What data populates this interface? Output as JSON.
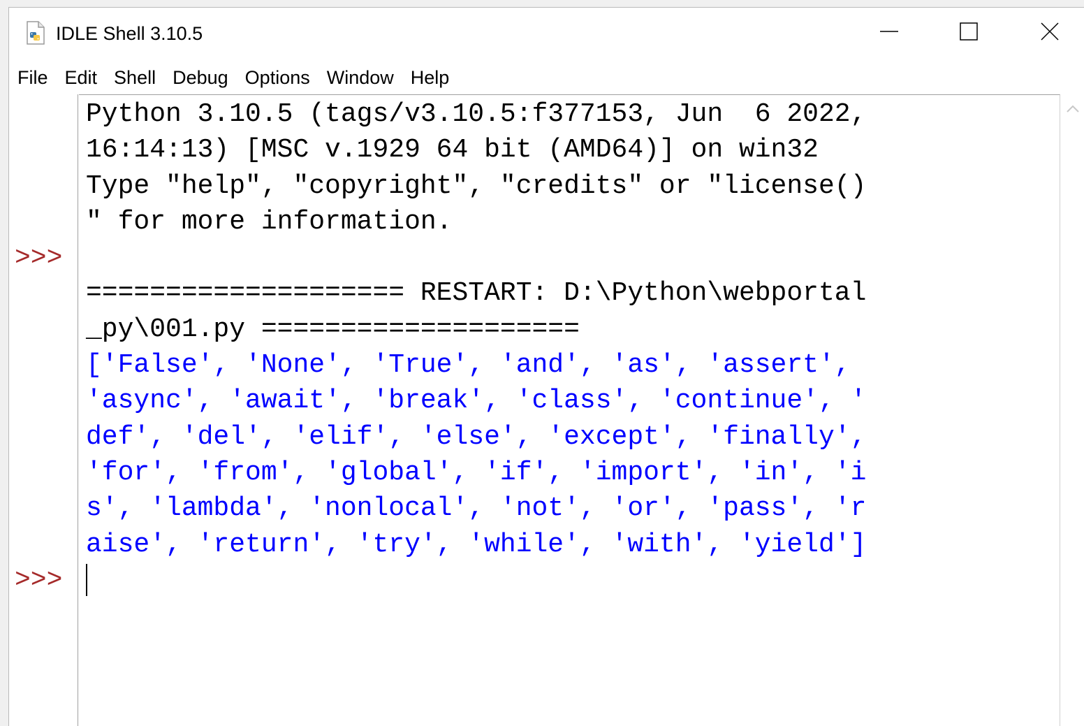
{
  "window": {
    "title": "IDLE Shell 3.10.5"
  },
  "menu": [
    "File",
    "Edit",
    "Shell",
    "Debug",
    "Options",
    "Window",
    "Help"
  ],
  "gutter": {
    "prompt_1": ">>>",
    "prompt_2": ">>>"
  },
  "shell": {
    "lines": [
      {
        "text": "Python 3.10.5 (tags/v3.10.5:f377153, Jun  6 2022,",
        "style": "default"
      },
      {
        "text": "16:14:13) [MSC v.1929 64 bit (AMD64)] on win32",
        "style": "default"
      },
      {
        "text": "Type \"help\", \"copyright\", \"credits\" or \"license()",
        "style": "default"
      },
      {
        "text": "\" for more information.",
        "style": "default"
      },
      {
        "text": "",
        "style": "default"
      },
      {
        "text": "==================== RESTART: D:\\Python\\webportal",
        "style": "default"
      },
      {
        "text": "_py\\001.py ====================",
        "style": "default"
      },
      {
        "text": "['False', 'None', 'True', 'and', 'as', 'assert',",
        "style": "stdout"
      },
      {
        "text": "'async', 'await', 'break', 'class', 'continue', '",
        "style": "stdout"
      },
      {
        "text": "def', 'del', 'elif', 'else', 'except', 'finally',",
        "style": "stdout"
      },
      {
        "text": "'for', 'from', 'global', 'if', 'import', 'in', 'i",
        "style": "stdout"
      },
      {
        "text": "s', 'lambda', 'nonlocal', 'not', 'or', 'pass', 'r",
        "style": "stdout"
      },
      {
        "text": "aise', 'return', 'try', 'while', 'with', 'yield']",
        "style": "stdout"
      },
      {
        "text": "",
        "style": "default"
      }
    ]
  },
  "icons": {
    "app": "python-file-icon",
    "minimize": "minimize-icon",
    "maximize": "maximize-icon",
    "close": "close-icon",
    "scroll_up": "chevron-up-icon"
  },
  "colors": {
    "prompt": "#a52a2a",
    "stdout": "#0000ff",
    "default_text": "#000000",
    "background": "#ffffff"
  }
}
